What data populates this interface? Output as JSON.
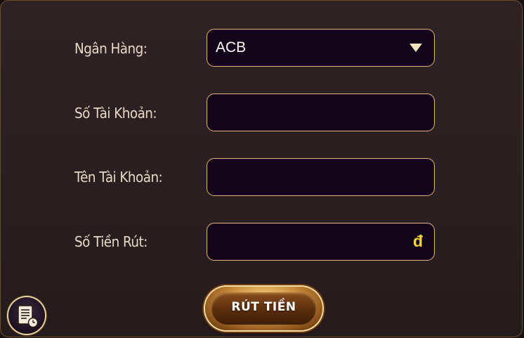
{
  "form": {
    "bank_label": "Ngân Hàng:",
    "bank_value": "ACB",
    "account_number_label": "Số Tài Khoản:",
    "account_number_value": "",
    "account_name_label": "Tên Tài Khoản:",
    "account_name_value": "",
    "amount_label": "Số Tiền Rút:",
    "amount_value": "",
    "currency_symbol": "đ"
  },
  "actions": {
    "withdraw_label": "RÚT TIỀN"
  },
  "icons": {
    "dropdown": "chevron-down-icon",
    "history": "history-document-icon"
  },
  "colors": {
    "field_border": "#d9b06a",
    "field_bg": "#130519",
    "currency": "#ffd630",
    "label": "#e8d8c4"
  }
}
